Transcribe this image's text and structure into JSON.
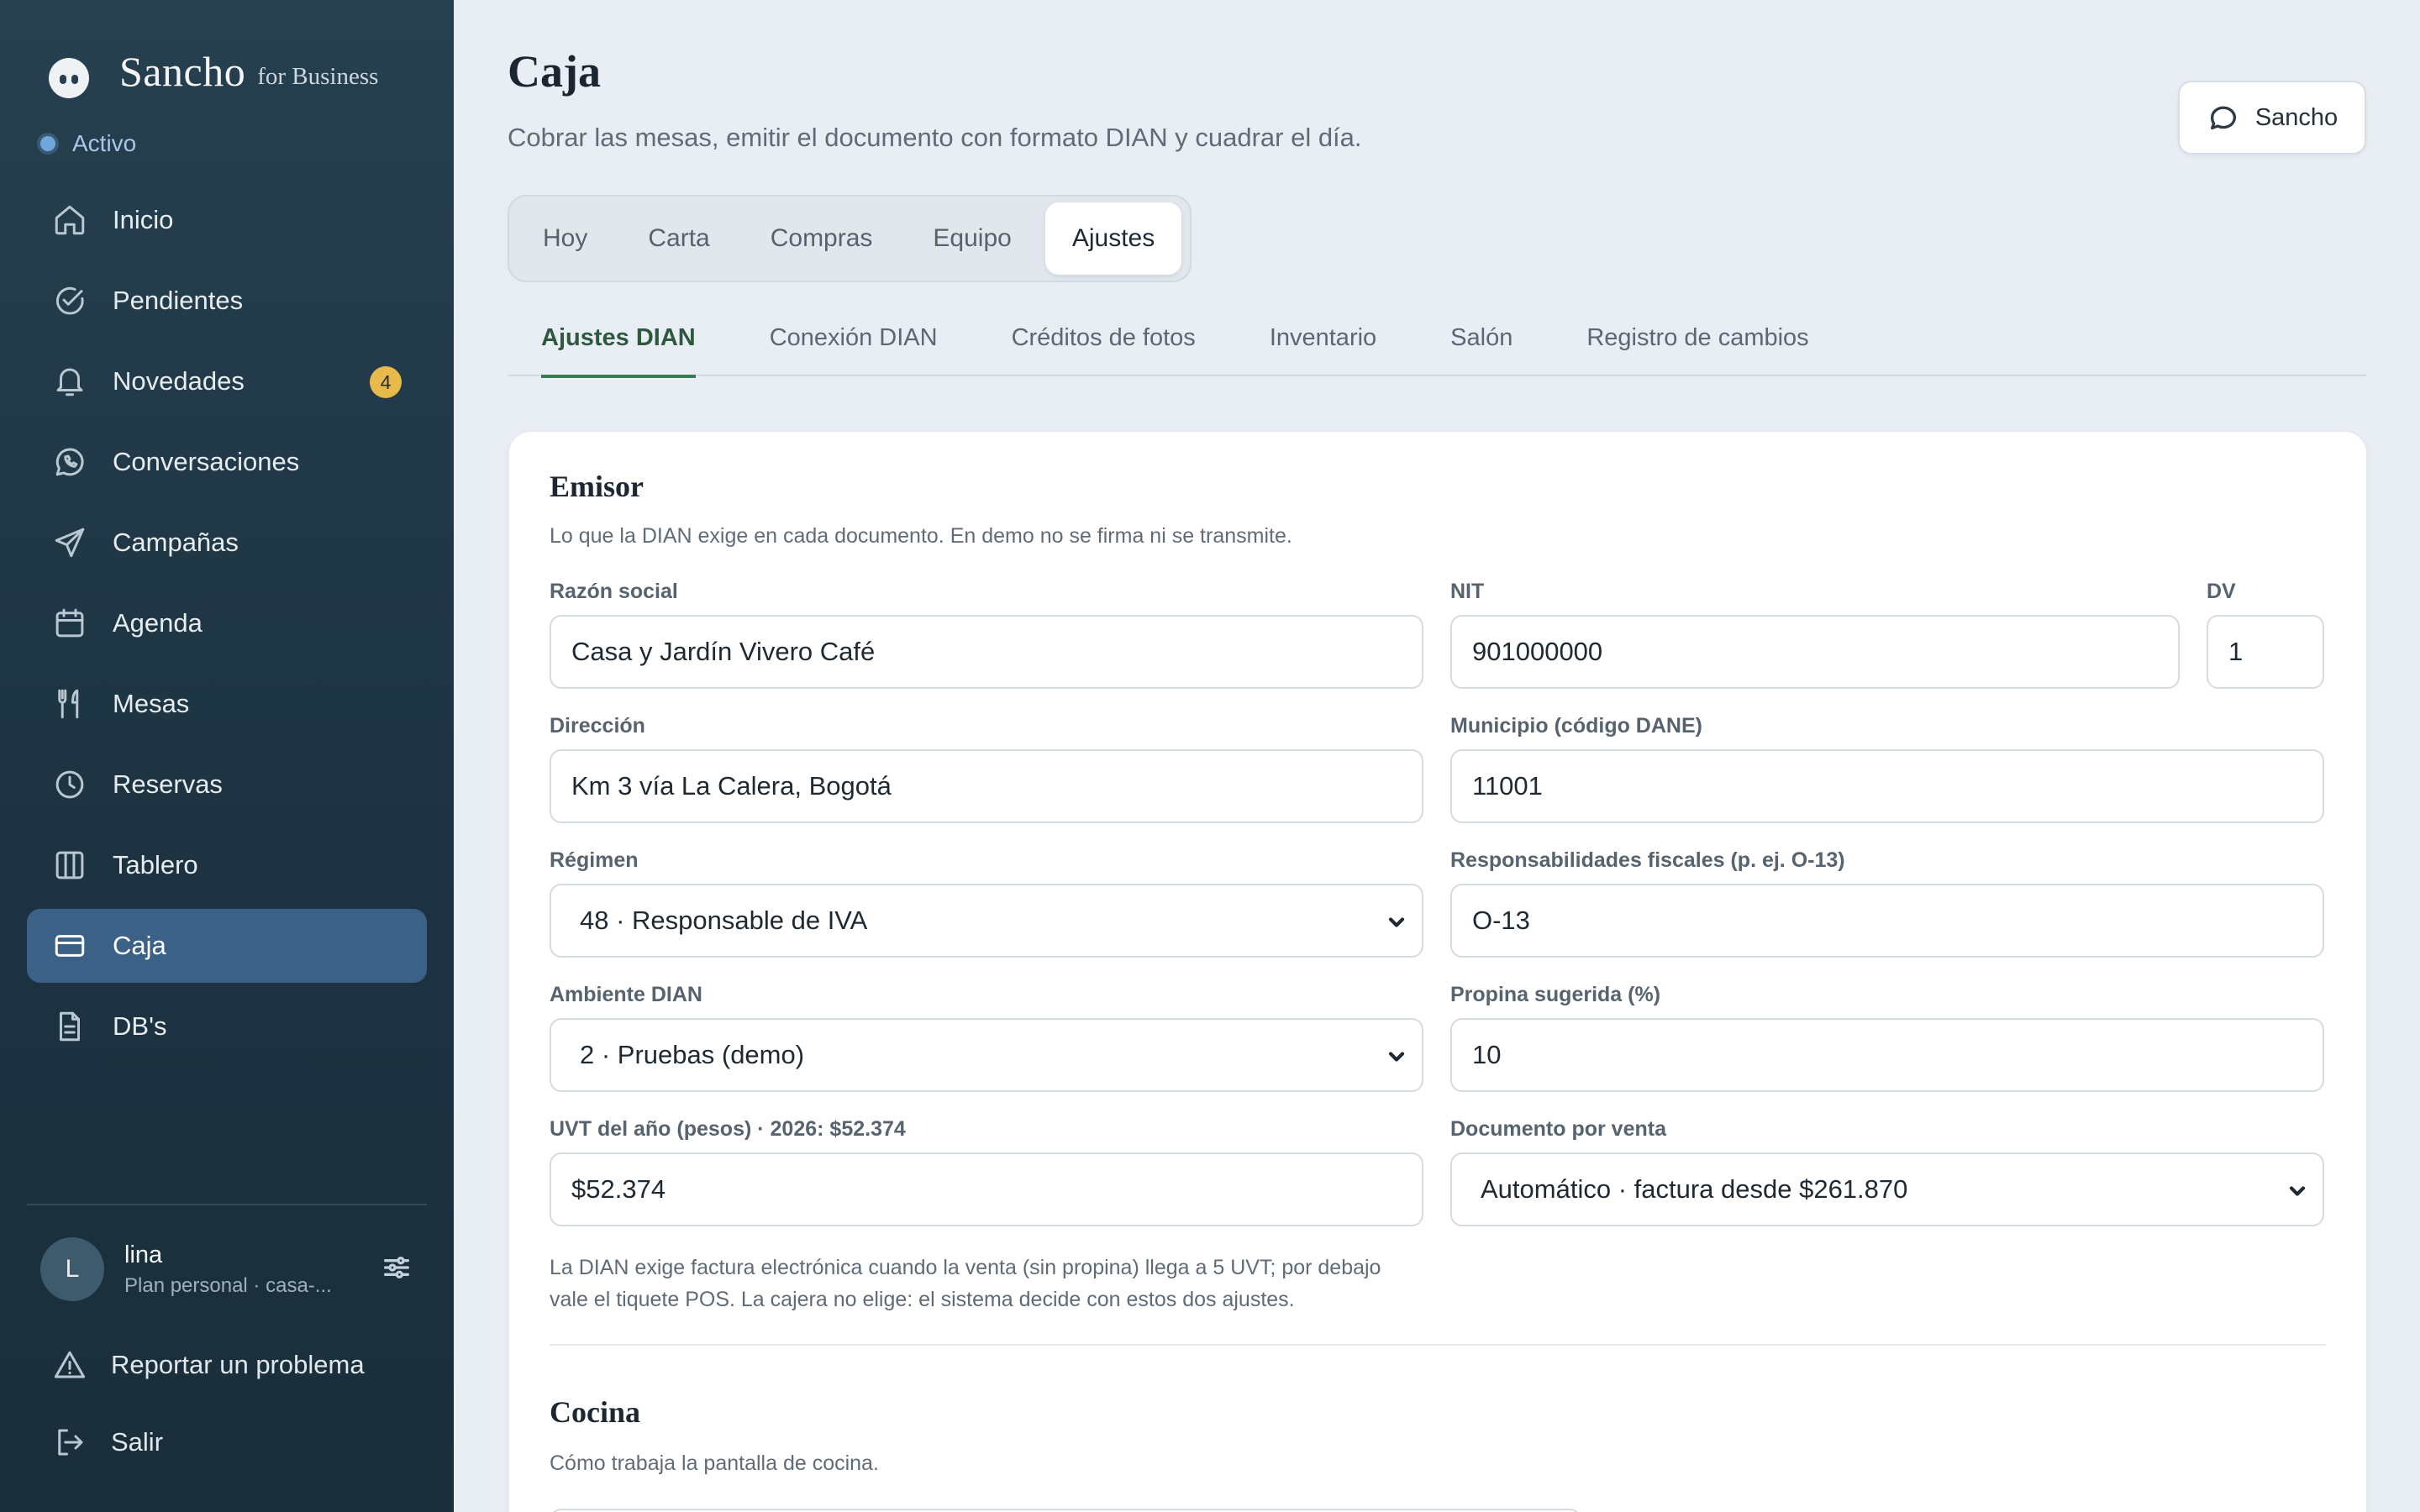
{
  "brand": {
    "name": "Sancho",
    "suffix": "for Business"
  },
  "status": {
    "label": "Activo"
  },
  "nav": {
    "items": [
      {
        "label": "Inicio",
        "icon": "home-icon"
      },
      {
        "label": "Pendientes",
        "icon": "check-circle-icon"
      },
      {
        "label": "Novedades",
        "icon": "bell-icon",
        "badge": "4"
      },
      {
        "label": "Conversaciones",
        "icon": "whatsapp-icon"
      },
      {
        "label": "Campañas",
        "icon": "send-icon"
      },
      {
        "label": "Agenda",
        "icon": "calendar-icon"
      },
      {
        "label": "Mesas",
        "icon": "utensils-icon"
      },
      {
        "label": "Reservas",
        "icon": "clock-icon"
      },
      {
        "label": "Tablero",
        "icon": "columns-icon"
      },
      {
        "label": "Caja",
        "icon": "credit-card-icon",
        "active": true
      },
      {
        "label": "DB's",
        "icon": "document-icon"
      }
    ]
  },
  "user": {
    "initial": "L",
    "name": "lina",
    "plan": "Plan personal · casa-..."
  },
  "footer": {
    "report": "Reportar un problema",
    "logout": "Salir"
  },
  "header": {
    "title": "Caja",
    "subtitle": "Cobrar las mesas, emitir el documento con formato DIAN y cuadrar el día.",
    "assistant_button": "Sancho"
  },
  "tabs": [
    "Hoy",
    "Carta",
    "Compras",
    "Equipo",
    "Ajustes"
  ],
  "active_tab": "Ajustes",
  "subtabs": [
    "Ajustes DIAN",
    "Conexión DIAN",
    "Créditos de fotos",
    "Inventario",
    "Salón",
    "Registro de cambios"
  ],
  "active_subtab": "Ajustes DIAN",
  "emisor": {
    "title": "Emisor",
    "description": "Lo que la DIAN exige en cada documento. En demo no se firma ni se transmite.",
    "razon_social": {
      "label": "Razón social",
      "value": "Casa y Jardín Vivero Café"
    },
    "nit": {
      "label": "NIT",
      "value": "901000000"
    },
    "dv": {
      "label": "DV",
      "value": "1"
    },
    "direccion": {
      "label": "Dirección",
      "value": "Km 3 vía La Calera, Bogotá"
    },
    "municipio": {
      "label": "Municipio (código DANE)",
      "value": "11001"
    },
    "regimen": {
      "label": "Régimen",
      "value": "48 · Responsable de IVA"
    },
    "responsabilidades": {
      "label": "Responsabilidades fiscales (p. ej. O-13)",
      "value": "O-13"
    },
    "ambiente": {
      "label": "Ambiente DIAN",
      "value": "2 · Pruebas (demo)"
    },
    "propina": {
      "label": "Propina sugerida (%)",
      "value": "10"
    },
    "uvt": {
      "label": "UVT del año (pesos) · 2026: $52.374",
      "value": "$52.374"
    },
    "documento": {
      "label": "Documento por venta",
      "value": "Automático · factura desde $261.870"
    },
    "hint_line1": "La DIAN exige factura electrónica cuando la venta (sin propina) llega a 5 UVT; por debajo",
    "hint_line2": "vale el tiquete POS. La cajera no elige: el sistema decide con estos dos ajustes."
  },
  "cocina": {
    "title": "Cocina",
    "description": "Cómo trabaja la pantalla de cocina."
  }
}
